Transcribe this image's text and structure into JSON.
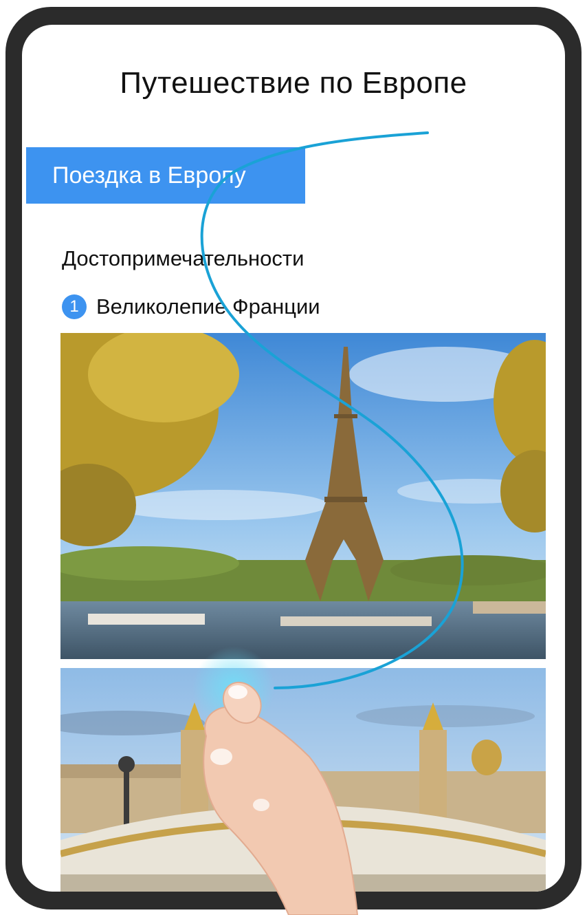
{
  "article": {
    "title": "Путешествие по Европе",
    "banner_label": "Поездка в Европу",
    "section_heading": "Достопримечательности",
    "item_number": "1",
    "item_title": "Великолепие Франции"
  },
  "colors": {
    "accent": "#3d93f0",
    "gesture_stroke": "#1aa2d6",
    "phone_frame": "#2b2b2b"
  },
  "images": [
    {
      "name": "eiffel-tower-photo"
    },
    {
      "name": "alexandre-iii-bridge-photo"
    }
  ],
  "gesture": {
    "type": "knuckle-draw-s"
  }
}
